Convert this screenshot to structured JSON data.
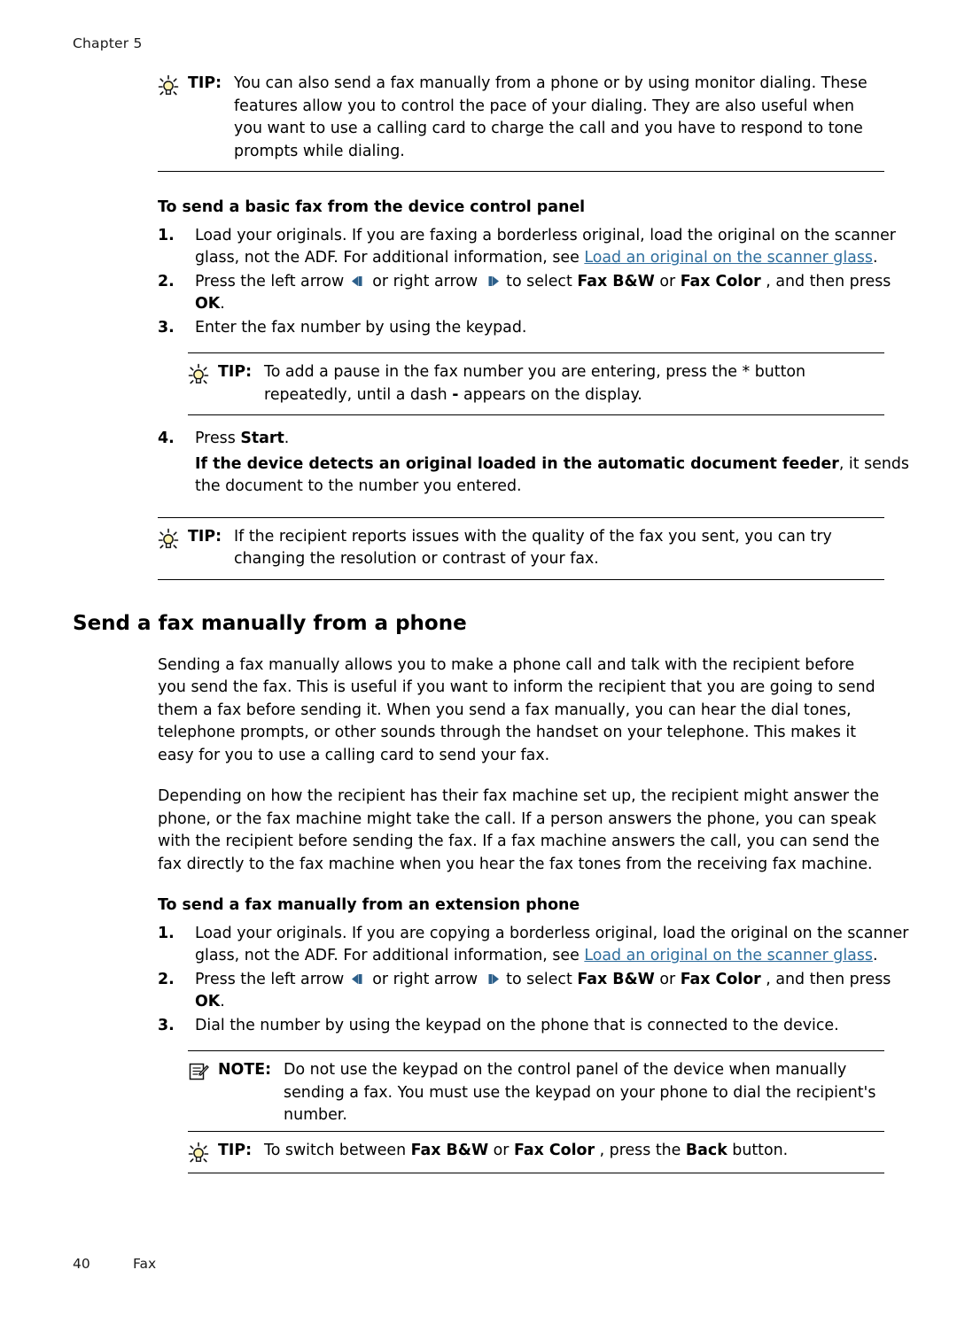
{
  "header": {
    "chapter": "Chapter 5"
  },
  "footer": {
    "page_number": "40",
    "section": "Fax"
  },
  "labels": {
    "tip": "TIP:",
    "note": "NOTE:"
  },
  "tip1": {
    "text": "You can also send a fax manually from a phone or by using monitor dialing. These features allow you to control the pace of your dialing. They are also useful when you want to use a calling card to charge the call and you have to respond to tone prompts while dialing."
  },
  "section1": {
    "heading": "To send a basic fax from the device control panel",
    "steps": [
      {
        "num": "1.",
        "text_a": "Load your originals. If you are faxing a borderless original, load the original on the scanner glass, not the ADF. For additional information, see ",
        "link": "Load an original on the scanner glass",
        "text_b": "."
      },
      {
        "num": "2.",
        "text_a": "Press the left arrow ",
        "text_b": " or right arrow ",
        "text_c": " to select ",
        "bold_a": "Fax B&W",
        "text_d": " or ",
        "bold_b": "Fax Color",
        "text_e": " , and then press ",
        "bold_c": "OK",
        "text_f": "."
      },
      {
        "num": "3.",
        "text_a": "Enter the fax number by using the keypad."
      },
      {
        "num": "4.",
        "text_a": "Press ",
        "bold_a": "Start",
        "text_b": ".",
        "sub_bold": "If the device detects an original loaded in the automatic document feeder",
        "sub_text": ", it sends the document to the number you entered."
      }
    ]
  },
  "tip2": {
    "text_a": "To add a pause in the fax number you are entering, press the * button repeatedly, until a dash ",
    "bold": "-",
    "text_b": " appears on the display."
  },
  "tip3": {
    "text": "If the recipient reports issues with the quality of the fax you sent, you can try changing the resolution or contrast of your fax."
  },
  "section2": {
    "heading": "Send a fax manually from a phone",
    "para1": "Sending a fax manually allows you to make a phone call and talk with the recipient before you send the fax. This is useful if you want to inform the recipient that you are going to send them a fax before sending it. When you send a fax manually, you can hear the dial tones, telephone prompts, or other sounds through the handset on your telephone. This makes it easy for you to use a calling card to send your fax.",
    "para2": "Depending on how the recipient has their fax machine set up, the recipient might answer the phone, or the fax machine might take the call. If a person answers the phone, you can speak with the recipient before sending the fax. If a fax machine answers the call, you can send the fax directly to the fax machine when you hear the fax tones from the receiving fax machine.",
    "sub_heading": "To send a fax manually from an extension phone",
    "steps": [
      {
        "num": "1.",
        "text_a": "Load your originals. If you are copying a borderless original, load the original on the scanner glass, not the ADF. For additional information, see ",
        "link": "Load an original on the scanner glass",
        "text_b": "."
      },
      {
        "num": "2.",
        "text_a": "Press the left arrow ",
        "text_b": " or right arrow ",
        "text_c": " to select ",
        "bold_a": "Fax B&W",
        "text_d": " or ",
        "bold_b": "Fax Color",
        "text_e": " , and then press ",
        "bold_c": "OK",
        "text_f": "."
      },
      {
        "num": "3.",
        "text_a": "Dial the number by using the keypad on the phone that is connected to the device."
      }
    ]
  },
  "note1": {
    "text": "Do not use the keypad on the control panel of the device when manually sending a fax. You must use the keypad on your phone to dial the recipient's number."
  },
  "tip4": {
    "text_a": "To switch between ",
    "bold_a": "Fax B&W",
    "text_b": " or ",
    "bold_b": "Fax Color",
    "text_c": " , press the ",
    "bold_c": "Back",
    "text_d": " button."
  },
  "colors": {
    "link": "#2e6e9e",
    "text": "#000000",
    "rule": "#000000"
  },
  "icons": {
    "tip": "lightbulb-icon",
    "note": "note-pencil-icon",
    "left_arrow": "left-arrow-button-icon",
    "right_arrow": "right-arrow-button-icon"
  }
}
